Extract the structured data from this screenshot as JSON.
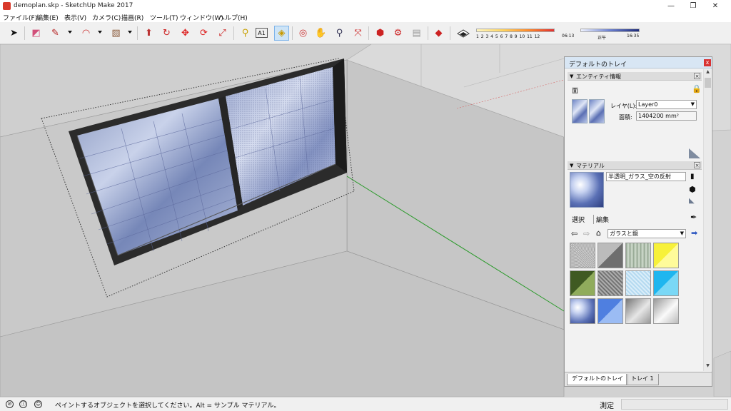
{
  "window": {
    "title": "demoplan.skp - SketchUp Make 2017",
    "controls": [
      "—",
      "❐",
      "✕"
    ]
  },
  "menu": [
    "ファイル(F)",
    "編集(E)",
    "表示(V)",
    "カメラ(C)",
    "描画(R)",
    "ツール(T)",
    "ウィンドウ(W)",
    "ヘルプ(H)"
  ],
  "toolbar": {
    "tools": [
      {
        "name": "select-tool-icon",
        "glyph": "➤"
      },
      {
        "name": "eraser-tool-icon",
        "glyph": "◩"
      },
      {
        "name": "pencil-tool-icon",
        "glyph": "✎"
      },
      {
        "name": "arc-tool-icon",
        "glyph": "◠"
      },
      {
        "name": "rectangle-tool-icon",
        "glyph": "▧"
      },
      {
        "name": "push-pull-tool-icon",
        "glyph": "⬆"
      },
      {
        "name": "follow-me-tool-icon",
        "glyph": "↻"
      },
      {
        "name": "move-tool-icon",
        "glyph": "✥"
      },
      {
        "name": "rotate-tool-icon",
        "glyph": "⟳"
      },
      {
        "name": "scale-tool-icon",
        "glyph": "⤢"
      },
      {
        "name": "tape-measure-tool-icon",
        "glyph": "⚲"
      },
      {
        "name": "text-tool-icon",
        "glyph": "A1"
      },
      {
        "name": "paint-bucket-tool-icon",
        "glyph": "🪣"
      },
      {
        "name": "orbit-tool-icon",
        "glyph": "◎"
      },
      {
        "name": "pan-tool-icon",
        "glyph": "✋"
      },
      {
        "name": "zoom-tool-icon",
        "glyph": "🔍"
      },
      {
        "name": "zoom-extents-tool-icon",
        "glyph": "⤧"
      },
      {
        "name": "3d-warehouse-icon",
        "glyph": "⬢"
      },
      {
        "name": "extension-warehouse-icon",
        "glyph": "⚙"
      },
      {
        "name": "layout-icon",
        "glyph": "▤"
      },
      {
        "name": "extension-manager-icon",
        "glyph": "◆"
      }
    ]
  },
  "shadow": {
    "months": "1 2 3 4 5 6 7 8 9 10 11 12",
    "time_start": "06:13",
    "time_noon": "正午",
    "time_end": "16:35"
  },
  "tray": {
    "title": "デフォルトのトレイ",
    "close": "x",
    "entity_panel": {
      "header": "エンティティ情報",
      "type": "面",
      "layer_label": "レイヤ(L):",
      "layer_value": "Layer0",
      "area_label": "面積:",
      "area_value": "1404200 mm²"
    },
    "material_panel": {
      "header": "マテリアル",
      "name": "半透明_ガラス_空の反射",
      "tab_select": "選択",
      "tab_edit": "編集",
      "library": "ガラスと鏡",
      "swatches": [
        {
          "style": "noise",
          "color": "#bdbdbd"
        },
        {
          "style": "split-gray",
          "color": "#8a8a8a"
        },
        {
          "style": "stripes-green",
          "color": "#b5c3ad"
        },
        {
          "style": "yellow",
          "color": "#f5ef2a"
        },
        {
          "style": "split-green",
          "color": "#4f6b2e"
        },
        {
          "style": "mesh-gray",
          "color": "#8e8e8e"
        },
        {
          "style": "grid-light",
          "color": "#cfe6f5"
        },
        {
          "style": "cyan",
          "color": "#29c1f0"
        },
        {
          "style": "sky",
          "color": "#6a80c4"
        },
        {
          "style": "blue-split",
          "color": "#6f97e6"
        },
        {
          "style": "gray-gradient",
          "color": "#a9a9a9"
        },
        {
          "style": "silver-gradient",
          "color": "#d6d6d6"
        }
      ]
    },
    "tabs": [
      "デフォルトのトレイ",
      "トレイ 1"
    ]
  },
  "status": {
    "message": "ペイントするオブジェクトを選択してください。Alt = サンプル マテリアル。",
    "measure_label": "測定",
    "measure_value": ""
  }
}
